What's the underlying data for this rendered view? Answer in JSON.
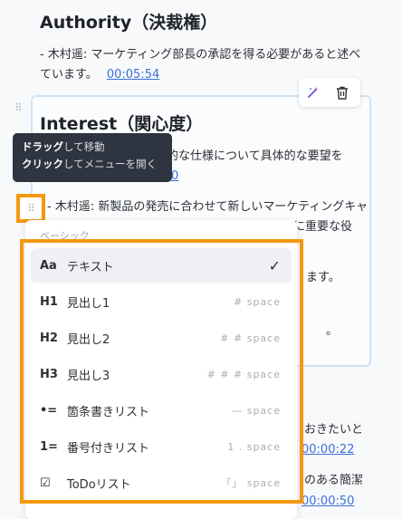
{
  "authority": {
    "heading": "Authority（決裁権）",
    "line1": "- 木村遥: マーケティング部長の承認を得る必要があると述べ",
    "line2": "ています。",
    "timestamp": "00:05:54"
  },
  "interest": {
    "heading": "Interest（関心度）",
    "line1_tail": "術的な仕様について具体的な要望を",
    "line2_tail": "0",
    "line3": "- 木村遥: 新製品の発売に合わせて新しいマーケティングキャ",
    "line4_tail": "に重要な役",
    "line5_tail": "ます。",
    "line6_tail": "。"
  },
  "below_card": {
    "line1_tail": "おきたいと",
    "ts1": "00:00:22",
    "line2_tail": "のある簡潔",
    "ts2": "00:00:50"
  },
  "toolbar": {
    "ai_icon": "magic-wand-icon",
    "delete_icon": "trash-icon"
  },
  "tooltip": {
    "drag_bold": "ドラッグ",
    "drag_rest": "して移動",
    "click_bold": "クリック",
    "click_rest": "してメニューを開く"
  },
  "menu": {
    "section": "ベーシック",
    "items": [
      {
        "icon": "Aa",
        "label": "テキスト",
        "hint": "",
        "selected": true
      },
      {
        "icon": "H1",
        "label": "見出し1",
        "hint": "# space"
      },
      {
        "icon": "H2",
        "label": "見出し2",
        "hint": "# # space"
      },
      {
        "icon": "H3",
        "label": "見出し3",
        "hint": "# # # space"
      },
      {
        "icon": "•=",
        "label": "箇条書きリスト",
        "hint": "— space"
      },
      {
        "icon": "1=",
        "label": "番号付きリスト",
        "hint": "1 . space"
      },
      {
        "icon": "☑",
        "label": "ToDoリスト",
        "hint": "「」 space"
      }
    ]
  }
}
